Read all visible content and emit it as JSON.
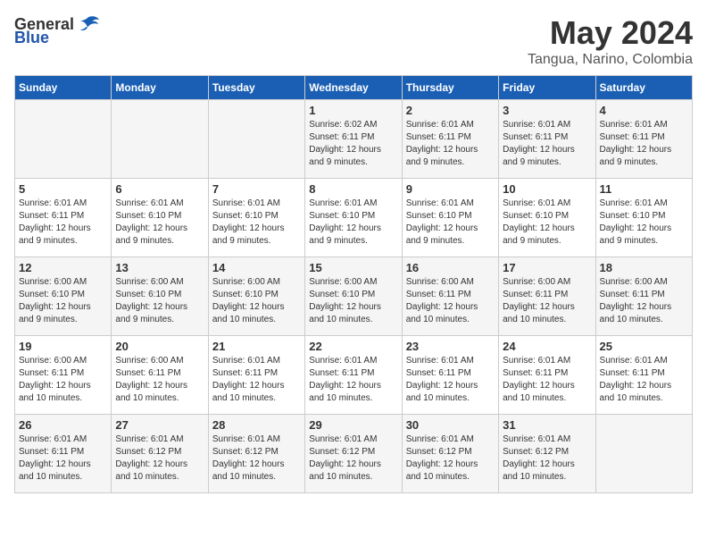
{
  "logo": {
    "general": "General",
    "blue": "Blue"
  },
  "title": {
    "month_year": "May 2024",
    "location": "Tangua, Narino, Colombia"
  },
  "header_days": [
    "Sunday",
    "Monday",
    "Tuesday",
    "Wednesday",
    "Thursday",
    "Friday",
    "Saturday"
  ],
  "weeks": [
    [
      {
        "day": "",
        "info": ""
      },
      {
        "day": "",
        "info": ""
      },
      {
        "day": "",
        "info": ""
      },
      {
        "day": "1",
        "info": "Sunrise: 6:02 AM\nSunset: 6:11 PM\nDaylight: 12 hours\nand 9 minutes."
      },
      {
        "day": "2",
        "info": "Sunrise: 6:01 AM\nSunset: 6:11 PM\nDaylight: 12 hours\nand 9 minutes."
      },
      {
        "day": "3",
        "info": "Sunrise: 6:01 AM\nSunset: 6:11 PM\nDaylight: 12 hours\nand 9 minutes."
      },
      {
        "day": "4",
        "info": "Sunrise: 6:01 AM\nSunset: 6:11 PM\nDaylight: 12 hours\nand 9 minutes."
      }
    ],
    [
      {
        "day": "5",
        "info": "Sunrise: 6:01 AM\nSunset: 6:11 PM\nDaylight: 12 hours\nand 9 minutes."
      },
      {
        "day": "6",
        "info": "Sunrise: 6:01 AM\nSunset: 6:10 PM\nDaylight: 12 hours\nand 9 minutes."
      },
      {
        "day": "7",
        "info": "Sunrise: 6:01 AM\nSunset: 6:10 PM\nDaylight: 12 hours\nand 9 minutes."
      },
      {
        "day": "8",
        "info": "Sunrise: 6:01 AM\nSunset: 6:10 PM\nDaylight: 12 hours\nand 9 minutes."
      },
      {
        "day": "9",
        "info": "Sunrise: 6:01 AM\nSunset: 6:10 PM\nDaylight: 12 hours\nand 9 minutes."
      },
      {
        "day": "10",
        "info": "Sunrise: 6:01 AM\nSunset: 6:10 PM\nDaylight: 12 hours\nand 9 minutes."
      },
      {
        "day": "11",
        "info": "Sunrise: 6:01 AM\nSunset: 6:10 PM\nDaylight: 12 hours\nand 9 minutes."
      }
    ],
    [
      {
        "day": "12",
        "info": "Sunrise: 6:00 AM\nSunset: 6:10 PM\nDaylight: 12 hours\nand 9 minutes."
      },
      {
        "day": "13",
        "info": "Sunrise: 6:00 AM\nSunset: 6:10 PM\nDaylight: 12 hours\nand 9 minutes."
      },
      {
        "day": "14",
        "info": "Sunrise: 6:00 AM\nSunset: 6:10 PM\nDaylight: 12 hours\nand 10 minutes."
      },
      {
        "day": "15",
        "info": "Sunrise: 6:00 AM\nSunset: 6:10 PM\nDaylight: 12 hours\nand 10 minutes."
      },
      {
        "day": "16",
        "info": "Sunrise: 6:00 AM\nSunset: 6:11 PM\nDaylight: 12 hours\nand 10 minutes."
      },
      {
        "day": "17",
        "info": "Sunrise: 6:00 AM\nSunset: 6:11 PM\nDaylight: 12 hours\nand 10 minutes."
      },
      {
        "day": "18",
        "info": "Sunrise: 6:00 AM\nSunset: 6:11 PM\nDaylight: 12 hours\nand 10 minutes."
      }
    ],
    [
      {
        "day": "19",
        "info": "Sunrise: 6:00 AM\nSunset: 6:11 PM\nDaylight: 12 hours\nand 10 minutes."
      },
      {
        "day": "20",
        "info": "Sunrise: 6:00 AM\nSunset: 6:11 PM\nDaylight: 12 hours\nand 10 minutes."
      },
      {
        "day": "21",
        "info": "Sunrise: 6:01 AM\nSunset: 6:11 PM\nDaylight: 12 hours\nand 10 minutes."
      },
      {
        "day": "22",
        "info": "Sunrise: 6:01 AM\nSunset: 6:11 PM\nDaylight: 12 hours\nand 10 minutes."
      },
      {
        "day": "23",
        "info": "Sunrise: 6:01 AM\nSunset: 6:11 PM\nDaylight: 12 hours\nand 10 minutes."
      },
      {
        "day": "24",
        "info": "Sunrise: 6:01 AM\nSunset: 6:11 PM\nDaylight: 12 hours\nand 10 minutes."
      },
      {
        "day": "25",
        "info": "Sunrise: 6:01 AM\nSunset: 6:11 PM\nDaylight: 12 hours\nand 10 minutes."
      }
    ],
    [
      {
        "day": "26",
        "info": "Sunrise: 6:01 AM\nSunset: 6:11 PM\nDaylight: 12 hours\nand 10 minutes."
      },
      {
        "day": "27",
        "info": "Sunrise: 6:01 AM\nSunset: 6:12 PM\nDaylight: 12 hours\nand 10 minutes."
      },
      {
        "day": "28",
        "info": "Sunrise: 6:01 AM\nSunset: 6:12 PM\nDaylight: 12 hours\nand 10 minutes."
      },
      {
        "day": "29",
        "info": "Sunrise: 6:01 AM\nSunset: 6:12 PM\nDaylight: 12 hours\nand 10 minutes."
      },
      {
        "day": "30",
        "info": "Sunrise: 6:01 AM\nSunset: 6:12 PM\nDaylight: 12 hours\nand 10 minutes."
      },
      {
        "day": "31",
        "info": "Sunrise: 6:01 AM\nSunset: 6:12 PM\nDaylight: 12 hours\nand 10 minutes."
      },
      {
        "day": "",
        "info": ""
      }
    ]
  ]
}
